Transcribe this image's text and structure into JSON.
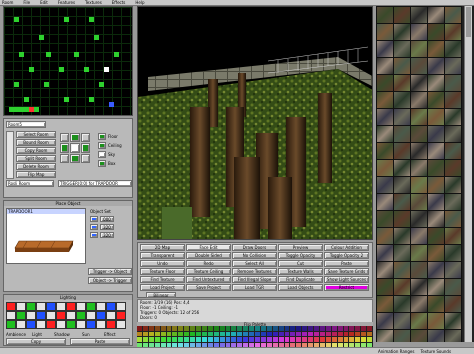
{
  "menu": {
    "items": [
      "Room",
      "File",
      "Edit",
      "Features",
      "Textures",
      "Effects",
      "Help"
    ]
  },
  "room": {
    "current_room_field": "Room5",
    "buttons": [
      "Select Room",
      "Bound Room",
      "Copy Room",
      "Split Room",
      "Delete Room",
      "Flip Map"
    ],
    "floor_label": "Floor",
    "ceiling_label": "Ceiling",
    "sky_label": "Sky",
    "box_label": "Box",
    "room_type_field": "Rosli Room",
    "trigger_field": "TRIGGER(0:0) for TRAPDOOR"
  },
  "object": {
    "section_title": "Place Object",
    "list_value": "TRAPDOOR1",
    "object_set_label": "Object Set",
    "set_values": [
      "000",
      "320",
      "320"
    ],
    "trigger_object_button": "Trigger -> Object",
    "object_trigger_button": "Object -> Trigger"
  },
  "lighting": {
    "title": "Lighting",
    "labels": [
      "Ambience",
      "Light",
      "Shadow",
      "Sun",
      "Effect"
    ],
    "copy_label": "Copy",
    "paste_label": "Paste"
  },
  "toolbar": {
    "rows": [
      [
        "2D Map",
        "Face Edit",
        "Draw Doors",
        "Preview",
        "Colour Addition"
      ],
      [
        "Transparent",
        "Double Sided",
        "No Collision",
        "Toggle Opacity",
        "Toggle Opacity 2"
      ],
      [
        "Undo",
        "Redo",
        "Select All",
        "Cut",
        "Paste"
      ],
      [
        "Texture Floor",
        "Texture Ceiling",
        "Remove Textures",
        "Texture Walls",
        "Save Texture Grids"
      ],
      [
        "Find Texture",
        "Find Untextured",
        "Find Illegal Slope",
        "Find Duplicate",
        "Show Light Sources"
      ],
      [
        "Load Project",
        "Save Project",
        "Load TGR",
        "Load Objects",
        "Restrict"
      ]
    ],
    "active_button": "Face Edit",
    "highlight_button": "Restrict",
    "bilinear_label": "Bilinear"
  },
  "info": {
    "lines": [
      "Room: 3/19 (16) Pos: 4,4",
      "Floor: -1 Ceiling: -1",
      "Triggers: 0 Objects: 12 of 256",
      "Doors: 0"
    ]
  },
  "palette": {
    "title": "Flip Palette"
  },
  "texture_panel": {
    "tab_left": "Animation Ranges",
    "tab_right": "Texture Sounds"
  },
  "colors": {
    "accent_magenta": "#e000e0",
    "map_green": "#2ed12e",
    "floor_button": "#1c8f1c",
    "ceiling_button": "#1c8f1c",
    "sky_button": "#ffffff",
    "box_button": "#1c8f1c"
  },
  "icons": [
    "trapdoor-preview-icon",
    "up-arrow-icon",
    "down-arrow-icon"
  ]
}
